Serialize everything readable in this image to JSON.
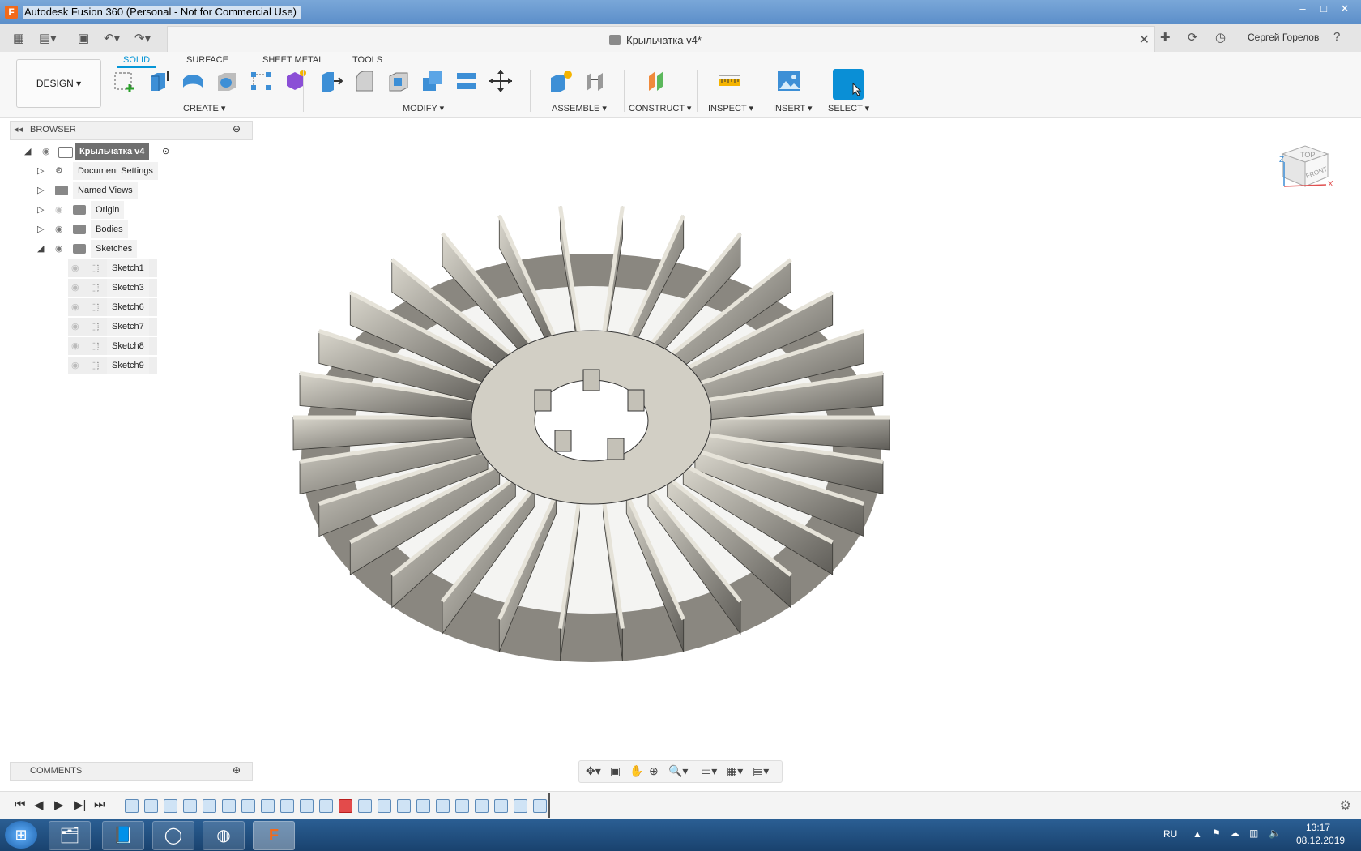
{
  "window": {
    "title": "Autodesk Fusion 360 (Personal - Not for Commercial Use)",
    "app_icon_letter": "F",
    "controls": [
      "–",
      "□",
      "✕"
    ]
  },
  "appbar": {
    "document_title": "Крыльчатка v4*",
    "close_glyph": "✕",
    "user": "Сергей Горелов",
    "help": "?"
  },
  "ribbon": {
    "workspace": "DESIGN ▾",
    "tabs": [
      "SOLID",
      "SURFACE",
      "SHEET METAL",
      "TOOLS"
    ],
    "groups": [
      "CREATE ▾",
      "MODIFY ▾",
      "ASSEMBLE ▾",
      "CONSTRUCT ▾",
      "INSPECT ▾",
      "INSERT ▾",
      "SELECT ▾"
    ]
  },
  "browser": {
    "title": "BROWSER",
    "root": "Крыльчатка v4",
    "items": [
      {
        "label": "Document Settings"
      },
      {
        "label": "Named Views"
      },
      {
        "label": "Origin"
      },
      {
        "label": "Bodies"
      },
      {
        "label": "Sketches"
      }
    ],
    "sketches": [
      "Sketch1",
      "Sketch3",
      "Sketch6",
      "Sketch7",
      "Sketch8",
      "Sketch9"
    ]
  },
  "comments": {
    "title": "COMMENTS"
  },
  "viewcube": {
    "top": "TOP",
    "front": "FRONT",
    "axis_x": "X",
    "axis_z": "Z"
  },
  "taskbar": {
    "language": "RU",
    "time": "13:17",
    "date": "08.12.2019"
  },
  "colors": {
    "accent": "#0696d7",
    "model_face": "#c9c6bb",
    "model_shadow": "#6e6c66"
  }
}
